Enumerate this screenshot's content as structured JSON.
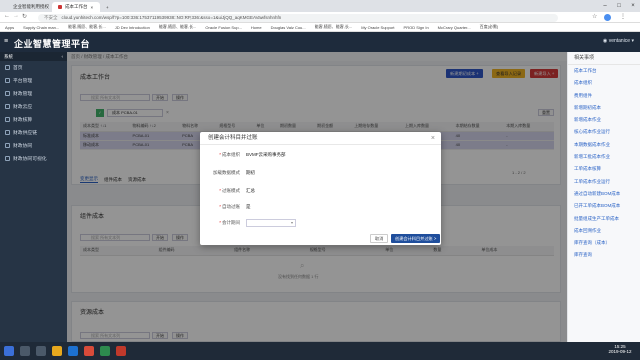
{
  "browser": {
    "tabs": [
      {
        "label": "企业智能利用授权"
      },
      {
        "label": "成本工作台"
      }
    ],
    "url": "cloud.yunhitech.com/wsp/f?p=100:336:17537119539938::NO:RP,336:&sso=1&uiJjQQ_aqKMGEAVawfsnhnhfn",
    "bookmarks": [
      "Apps",
      "Supply Chain man...",
      "能客,随愿、能客,长...",
      "JD Dev Introduction",
      "能客,随愿、能客,长...",
      "Oracle Fusion Sup...",
      "Home",
      "Douglas Valz Cou...",
      "能客,随愿、能客,长...",
      "My Oracle Support",
      "PROD Sign In",
      "McCrary Quarter...",
      "百度(必需)"
    ],
    "not_secure": "不安全"
  },
  "app": {
    "title": "企业智慧管理平台",
    "user": "ventanice"
  },
  "sidebar": {
    "header": "系统",
    "items": [
      {
        "label": "首页"
      },
      {
        "label": "平台管理"
      },
      {
        "label": "财政管理"
      },
      {
        "label": "财政云应"
      },
      {
        "label": "财政核算"
      },
      {
        "label": "财政供应链"
      },
      {
        "label": "财政协同"
      },
      {
        "label": "财政协同可视化"
      }
    ]
  },
  "breadcrumbs": "首页  /  财政管理  /  成本工作台",
  "workbench": {
    "title": "成本工作台",
    "buttons": {
      "first": "新建期初成本 +",
      "second": "查看导入记录",
      "third": "新建导入 +"
    },
    "search_placeholder": "搜索 所有文本列",
    "go_label": "开始",
    "actions_label": "操作",
    "filter_chip": "成本 PCBA-01",
    "reset_label": "重置",
    "table": {
      "columns": [
        "成本类型 ↑↓1",
        "物料编码 ↑↓2",
        "物料名称",
        "规格型号",
        "单位",
        "期初数量",
        "期初金额",
        "上期结存数量",
        "上期入库数量",
        "本期结存数量",
        "本期入库数量"
      ],
      "rows": [
        [
          "标准成本",
          "PCBA-01",
          "PCBA",
          "-",
          "-",
          "-",
          "-",
          "-",
          "-",
          "40",
          "-"
        ],
        [
          "移动成本",
          "PCBA-01",
          "PCBA",
          "-",
          "-",
          "-",
          "-",
          "-",
          "-",
          "40",
          "-"
        ]
      ],
      "pagination": "1 - 2 / 2"
    },
    "tabs": [
      "变更显示",
      "组件成本",
      "资源成本"
    ]
  },
  "components_section": {
    "title": "组件成本",
    "search_placeholder": "搜索 所有文本列",
    "go_label": "开始",
    "actions_label": "操作",
    "columns": [
      "成本类型",
      "组件编码",
      "组件名称",
      "规格型号",
      "单位",
      "数量",
      "单位成本"
    ],
    "empty_text": "没有找到任何数据 1 行"
  },
  "resources_section": {
    "title": "资源成本",
    "search_placeholder": "搜索 所有文本列",
    "go_label": "开始",
    "actions_label": "操作"
  },
  "right_panel": {
    "header": "相关事项",
    "links": [
      "成本工作台",
      "成本组织",
      "费用组件",
      "新增期初成本",
      "新增成本作业",
      "核心成本作业运行",
      "本期数据成本作业",
      "新增工批成本作业",
      "工单成本核算",
      "工单成本作业运行",
      "通过自动新建BOM成本",
      "已开工单成本BOM成本",
      "批量组成生产工单成本",
      "成本回溯作业",
      "库存查询（成本）",
      "库存查询"
    ]
  },
  "modal": {
    "title": "创建会计科目并过账",
    "fields": [
      {
        "label": "成本组织",
        "value": "BVMF云采购事务部",
        "required": true
      },
      {
        "label": "加载数据模式",
        "value": "期初",
        "required": false
      },
      {
        "label": "过账模式",
        "value": "汇总",
        "required": true
      },
      {
        "label": "自动过账",
        "value": "是",
        "required": true
      },
      {
        "label": "会计期间",
        "value": "",
        "required": true
      }
    ],
    "cancel_label": "取消",
    "submit_label": "创建会计科目并过账 >"
  },
  "taskbar": {
    "time": "15:25",
    "date": "2019-09-12"
  },
  "colors": {
    "header_bg": "#1e2b3c",
    "sidebar_bg": "#263445",
    "btn_blue": "#2f57c8",
    "btn_yellow": "#f0b323",
    "btn_red": "#d43a3a",
    "submit_blue": "#1f4e9c",
    "chip_green": "#43b36b"
  }
}
